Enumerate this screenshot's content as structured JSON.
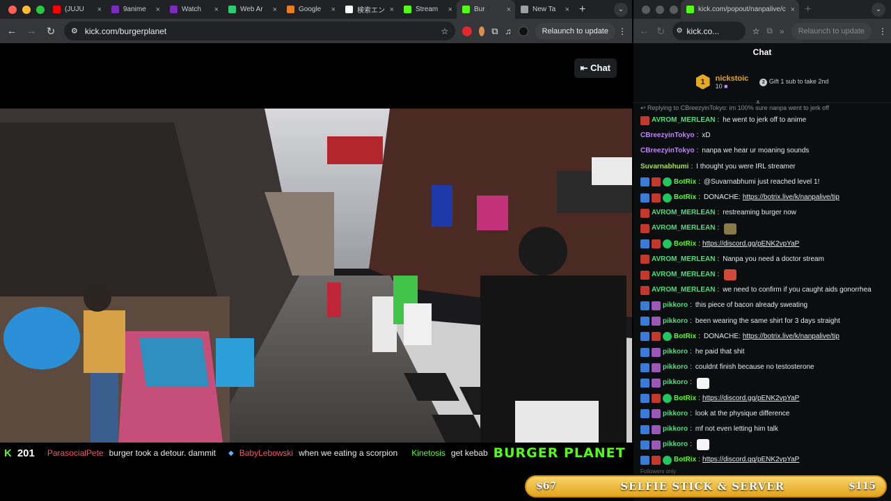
{
  "left_window": {
    "tabs": [
      {
        "label": "(JUJU",
        "color": "#ff0000"
      },
      {
        "label": "9anime",
        "color": "#7b2cbf"
      },
      {
        "label": "Watch",
        "color": "#7b2cbf"
      },
      {
        "label": "Web Ar",
        "color": "#2ecc71"
      },
      {
        "label": "Google",
        "color": "#e67e22"
      },
      {
        "label": "検索エン",
        "color": "#ffffff"
      },
      {
        "label": "Stream",
        "color": "#53fc18"
      },
      {
        "label": "Bur",
        "color": "#53fc18"
      },
      {
        "label": "New Ta",
        "color": "#9aa0a6"
      }
    ],
    "url": "kick.com/burgerplanet",
    "relaunch": "Relaunch to update",
    "chat_button": "Chat"
  },
  "ticker": {
    "viewers": "201",
    "items": [
      {
        "user": "ParasocialPete",
        "text": "burger took a detour. dammit"
      },
      {
        "user": "BabyLebowski",
        "text": "when we eating a scorpion"
      },
      {
        "user": "Kinetosis",
        "text": "get kebab"
      }
    ],
    "brand": "BURGER PLANET"
  },
  "right_window": {
    "url": "kick.com/popout/nanpalive/c",
    "omni_short": "kick.co...",
    "relaunch": "Relaunch to update",
    "chat_title": "Chat",
    "pinned": {
      "rank": "1",
      "name": "nickstoic",
      "subs": "10",
      "gift_text": "Gift 1 sub to take 2nd",
      "gift_num": "2"
    },
    "reply_line": "Replying to CBreezyinTokyo: im 100% sure nanpa went to jerk off",
    "messages": [
      {
        "badges": [
          "red"
        ],
        "user": "AVROM_MERLEAN",
        "color": "#4ade80",
        "text": "he went to jerk off to anime"
      },
      {
        "badges": [],
        "user": "CBreezyinTokyo",
        "color": "#c084fc",
        "text": "xD"
      },
      {
        "badges": [],
        "user": "CBreezyinTokyo",
        "color": "#c084fc",
        "text": "nanpa we hear ur moaning sounds"
      },
      {
        "badges": [],
        "user": "Suvarnabhumi",
        "color": "#a3e635",
        "text": "I thought you were IRL streamer"
      },
      {
        "badges": [
          "ar",
          "red",
          "gr"
        ],
        "user": "BotRix",
        "color": "#53fc18",
        "text": "@Suvarnabhumi just reached level 1!"
      },
      {
        "badges": [
          "ar",
          "red",
          "gr"
        ],
        "user": "BotRix",
        "color": "#53fc18",
        "text": "DONACHE: ",
        "link": "https://botrix.live/k/nanpalive/tip"
      },
      {
        "badges": [
          "red"
        ],
        "user": "AVROM_MERLEAN",
        "color": "#4ade80",
        "text": "restreaming burger now"
      },
      {
        "badges": [
          "red"
        ],
        "user": "AVROM_MERLEAN",
        "color": "#4ade80",
        "emote": "#8a7a4a"
      },
      {
        "badges": [
          "ar",
          "red",
          "gr"
        ],
        "user": "BotRix",
        "color": "#53fc18",
        "link": "https://discord.gg/pENK2vpYaP"
      },
      {
        "badges": [
          "red"
        ],
        "user": "AVROM_MERLEAN",
        "color": "#4ade80",
        "text": "Nanpa you need a doctor stream"
      },
      {
        "badges": [
          "red"
        ],
        "user": "AVROM_MERLEAN",
        "color": "#4ade80",
        "emote": "#d04a3a"
      },
      {
        "badges": [
          "red"
        ],
        "user": "AVROM_MERLEAN",
        "color": "#4ade80",
        "text": "we need to confirm if you caught aids gonorrhea"
      },
      {
        "badges": [
          "ar",
          "pu"
        ],
        "user": "pikkoro",
        "color": "#4ade80",
        "text": "this piece of bacon already sweating"
      },
      {
        "badges": [
          "ar",
          "pu"
        ],
        "user": "pikkoro",
        "color": "#4ade80",
        "text": "been wearing the same shirt for 3 days straight"
      },
      {
        "badges": [
          "ar",
          "red",
          "gr"
        ],
        "user": "BotRix",
        "color": "#53fc18",
        "text": "DONACHE: ",
        "link": "https://botrix.live/k/nanpalive/tip"
      },
      {
        "badges": [
          "ar",
          "pu"
        ],
        "user": "pikkoro",
        "color": "#4ade80",
        "text": "he paid that shit"
      },
      {
        "badges": [
          "ar",
          "pu"
        ],
        "user": "pikkoro",
        "color": "#4ade80",
        "text": "couldnt finish because no testosterone"
      },
      {
        "badges": [
          "ar",
          "pu"
        ],
        "user": "pikkoro",
        "color": "#4ade80",
        "emote": "#f5f5f5"
      },
      {
        "badges": [
          "ar",
          "red",
          "gr"
        ],
        "user": "BotRix",
        "color": "#53fc18",
        "link": "https://discord.gg/pENK2vpYaP"
      },
      {
        "badges": [
          "ar",
          "pu"
        ],
        "user": "pikkoro",
        "color": "#4ade80",
        "text": "look at the physique difference"
      },
      {
        "badges": [
          "ar",
          "pu"
        ],
        "user": "pikkoro",
        "color": "#4ade80",
        "text": "mf not even letting him talk"
      },
      {
        "badges": [
          "ar",
          "pu"
        ],
        "user": "pikkoro",
        "color": "#4ade80",
        "emote": "#f5f5f5"
      },
      {
        "badges": [
          "ar",
          "red",
          "gr"
        ],
        "user": "BotRix",
        "color": "#53fc18",
        "link": "https://discord.gg/pENK2vpYaP"
      }
    ],
    "followers_only": "Followers only"
  },
  "goal": {
    "left": "$67",
    "title": "SELFIE STICK & SERVER",
    "right": "$115"
  }
}
